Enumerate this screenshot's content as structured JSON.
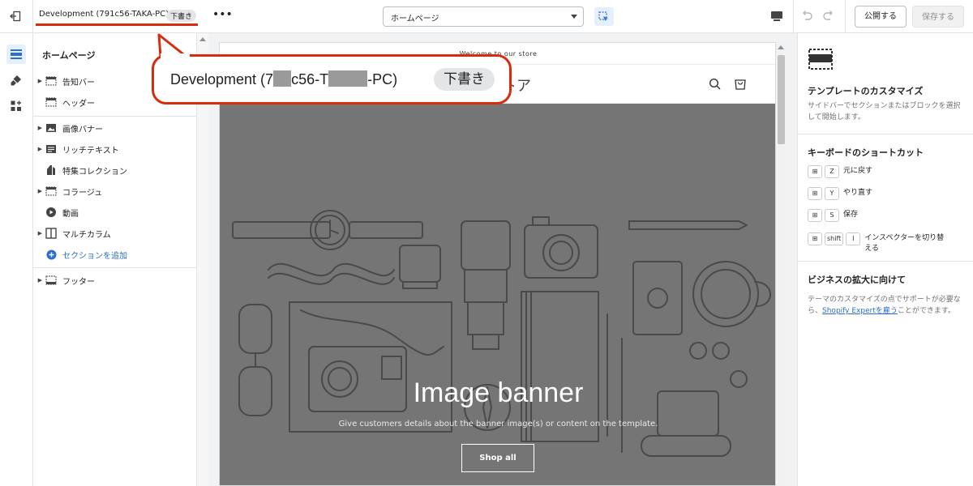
{
  "topbar": {
    "store_name": "Development (791c56-TAKA-PC)",
    "status_badge": "下書き",
    "more": "•••",
    "page_select": "ホームページ",
    "publish": "公開する",
    "save": "保存する"
  },
  "sections": {
    "title": "ホームページ",
    "items": [
      {
        "label": "告知バー",
        "icon": "announcement-icon"
      },
      {
        "label": "ヘッダー",
        "icon": "header-icon"
      },
      {
        "label": "画像バナー",
        "icon": "image-icon"
      },
      {
        "label": "リッチテキスト",
        "icon": "text-icon"
      },
      {
        "label": "特集コレクション",
        "icon": "tag-icon"
      },
      {
        "label": "コラージュ",
        "icon": "collage-icon"
      },
      {
        "label": "動画",
        "icon": "play-icon"
      },
      {
        "label": "マルチカラム",
        "icon": "columns-icon"
      },
      {
        "label": "セクションを追加",
        "icon": "add-icon"
      },
      {
        "label": "フッター",
        "icon": "footer-icon"
      }
    ]
  },
  "preview": {
    "announcement": "Welcome to our store",
    "logo": "ストア",
    "banner_title": "Image banner",
    "banner_subtitle": "Give customers details about the banner image(s) or content on the template.",
    "banner_button": "Shop all"
  },
  "right_panel": {
    "title": "テンプレートのカスタマイズ",
    "description": "サイドバーでセクションまたはブロックを選択して開始します。",
    "shortcuts_title": "キーボードのショートカット",
    "shortcuts": [
      {
        "keys": [
          "⊞",
          "Z"
        ],
        "label": "元に戻す"
      },
      {
        "keys": [
          "⊞",
          "Y"
        ],
        "label": "やり直す"
      },
      {
        "keys": [
          "⊞",
          "S"
        ],
        "label": "保存"
      },
      {
        "keys": [
          "⊞",
          "shift",
          "I"
        ],
        "label": "インスペクターを切り替える"
      }
    ],
    "grow_title": "ビジネスの拡大に向けて",
    "grow_text_1": "テーマのカスタマイズの点でサポートが必要なら、",
    "grow_link": "Shopify Expertを雇う",
    "grow_text_2": "ことができます。"
  },
  "callout": {
    "text_a": "Development (7",
    "text_b": "c56-T",
    "text_c": "-PC)",
    "badge": "下書き"
  },
  "colors": {
    "accent": "#2c6ecb",
    "highlight_red": "#d72c0d",
    "banner_bg": "#757575"
  }
}
